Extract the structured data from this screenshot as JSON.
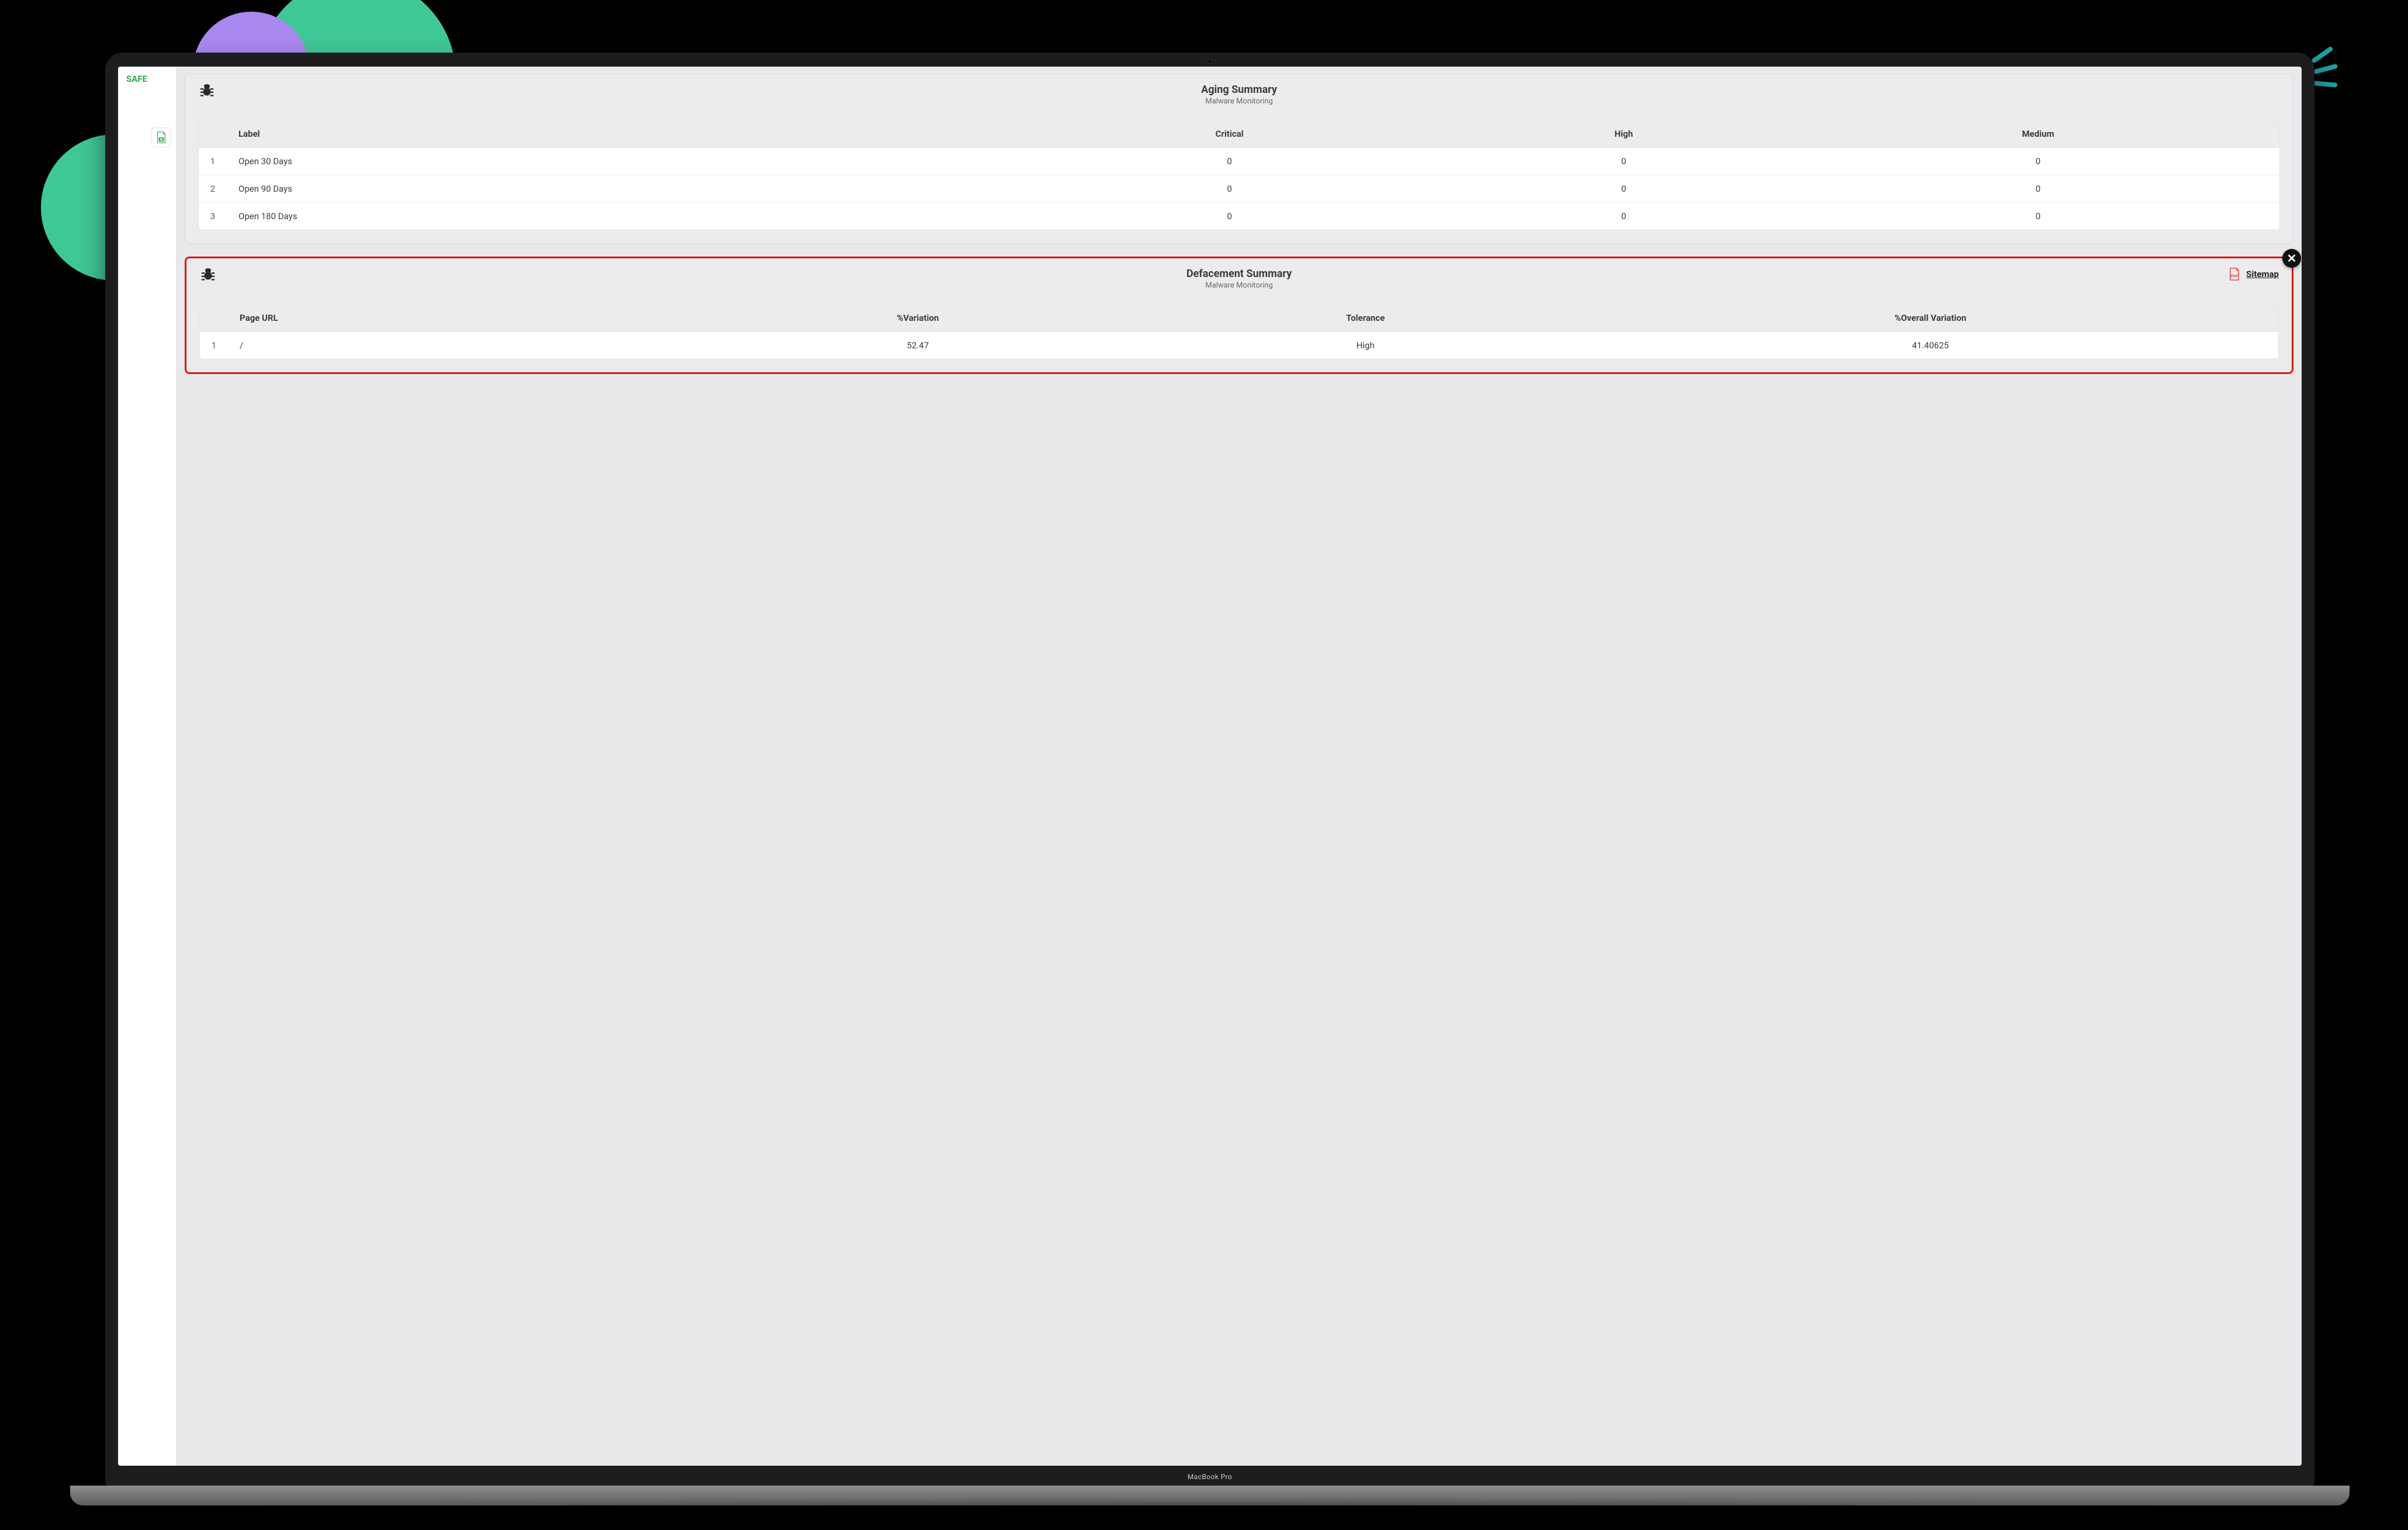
{
  "decor": {
    "base_label": "MacBook Pro"
  },
  "sidebar": {
    "safe_label": "SAFE"
  },
  "aging": {
    "title": "Aging Summary",
    "subtitle": "Malware Monitoring",
    "columns": [
      "",
      "Label",
      "Critical",
      "High",
      "Medium"
    ],
    "rows": [
      {
        "idx": "1",
        "label": "Open 30 Days",
        "critical": "0",
        "high": "0",
        "medium": "0"
      },
      {
        "idx": "2",
        "label": "Open 90 Days",
        "critical": "0",
        "high": "0",
        "medium": "0"
      },
      {
        "idx": "3",
        "label": "Open 180 Days",
        "critical": "0",
        "high": "0",
        "medium": "0"
      }
    ]
  },
  "defacement": {
    "title": "Defacement Summary",
    "subtitle": "Malware Monitoring",
    "sitemap_label": "Sitemap",
    "columns": [
      "",
      "Page URL",
      "%Variation",
      "Tolerance",
      "%Overall Variation"
    ],
    "rows": [
      {
        "idx": "1",
        "url": "/",
        "variation": "52.47",
        "tolerance": "High",
        "overall": "41.40625"
      }
    ]
  }
}
